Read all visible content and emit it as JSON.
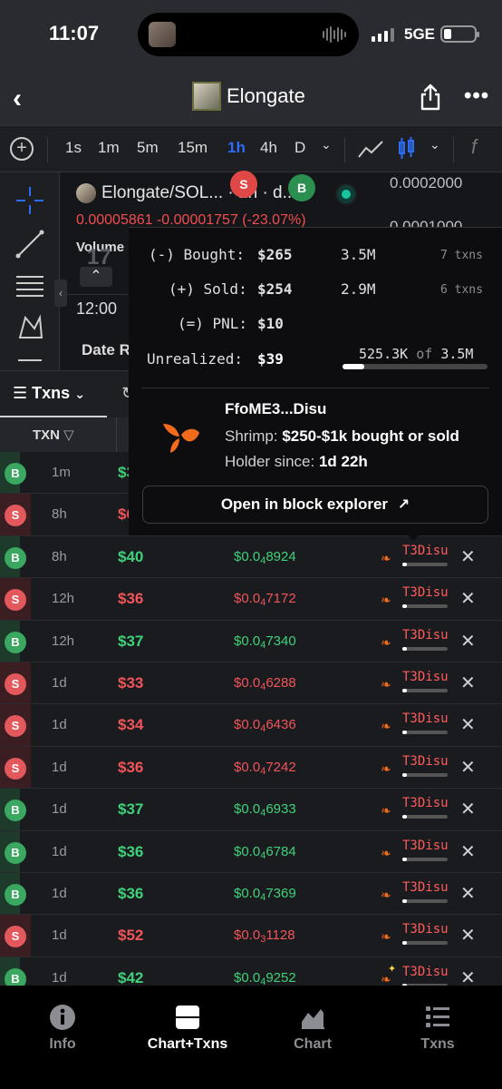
{
  "status": {
    "time": "11:07",
    "network": "5GE"
  },
  "nav": {
    "title": "Elongate"
  },
  "toolbar": {
    "intervals": [
      "1s",
      "1m",
      "5m",
      "15m",
      "1h",
      "4h",
      "D"
    ],
    "active_interval": "1h"
  },
  "chart": {
    "pair": "Elongate/SOL... · 1h · d...",
    "price_line": "0.00005861 -0.00001757 (-23.07%)",
    "volume_label": "Volume",
    "axis_prices": [
      "0.0002000",
      "0.0001000"
    ],
    "time_label": "12:00",
    "date_label": "Date R",
    "marker_sell": "S",
    "marker_buy": "B",
    "candle_label": "17"
  },
  "txns": {
    "tab_label": "Txns",
    "column_txn": "TXN",
    "rows": [
      {
        "type": "B",
        "age": "1m",
        "usd": "$3",
        "price_pre": "",
        "price_sub": "",
        "price_post": "",
        "maker": "",
        "bar": 0
      },
      {
        "type": "S",
        "age": "8h",
        "usd": "$6",
        "price_pre": "",
        "price_sub": "",
        "price_post": "",
        "maker": "",
        "bar": 0
      },
      {
        "type": "B",
        "age": "8h",
        "usd": "$40",
        "price_pre": "$0.0",
        "price_sub": "4",
        "price_post": "8924",
        "maker": "T3Disu",
        "bar": 0.1
      },
      {
        "type": "S",
        "age": "12h",
        "usd": "$36",
        "price_pre": "$0.0",
        "price_sub": "4",
        "price_post": "7172",
        "maker": "T3Disu",
        "bar": 0.1
      },
      {
        "type": "B",
        "age": "12h",
        "usd": "$37",
        "price_pre": "$0.0",
        "price_sub": "4",
        "price_post": "7340",
        "maker": "T3Disu",
        "bar": 0.1
      },
      {
        "type": "S",
        "age": "1d",
        "usd": "$33",
        "price_pre": "$0.0",
        "price_sub": "4",
        "price_post": "6288",
        "maker": "T3Disu",
        "bar": 0.1
      },
      {
        "type": "S",
        "age": "1d",
        "usd": "$34",
        "price_pre": "$0.0",
        "price_sub": "4",
        "price_post": "6436",
        "maker": "T3Disu",
        "bar": 0.1
      },
      {
        "type": "S",
        "age": "1d",
        "usd": "$36",
        "price_pre": "$0.0",
        "price_sub": "4",
        "price_post": "7242",
        "maker": "T3Disu",
        "bar": 0.1
      },
      {
        "type": "B",
        "age": "1d",
        "usd": "$37",
        "price_pre": "$0.0",
        "price_sub": "4",
        "price_post": "6933",
        "maker": "T3Disu",
        "bar": 0.1
      },
      {
        "type": "B",
        "age": "1d",
        "usd": "$36",
        "price_pre": "$0.0",
        "price_sub": "4",
        "price_post": "6784",
        "maker": "T3Disu",
        "bar": 0.1
      },
      {
        "type": "B",
        "age": "1d",
        "usd": "$36",
        "price_pre": "$0.0",
        "price_sub": "4",
        "price_post": "7369",
        "maker": "T3Disu",
        "bar": 0.1
      },
      {
        "type": "S",
        "age": "1d",
        "usd": "$52",
        "price_pre": "$0.0",
        "price_sub": "3",
        "price_post": "1128",
        "maker": "T3Disu",
        "bar": 0.1
      },
      {
        "type": "B",
        "age": "1d",
        "usd": "$42",
        "price_pre": "$0.0",
        "price_sub": "4",
        "price_post": "9252",
        "maker": "T3Disu",
        "bar": 0.1
      }
    ]
  },
  "popup": {
    "bought_label": "(-) Bought:",
    "bought_value": "$265",
    "bought_qty": "3.5M",
    "bought_txns": "7 txns",
    "sold_label": "(+) Sold:",
    "sold_value": "$254",
    "sold_qty": "2.9M",
    "sold_txns": "6 txns",
    "pnl_label": "(=) PNL:",
    "pnl_value": "$10",
    "unrealized_label": "Unrealized:",
    "unrealized_value": "$39",
    "holding": "525.3K",
    "holding_of": "of",
    "holding_total": "3.5M",
    "holding_fraction": 0.15,
    "wallet": "FfoME3...Disu",
    "tier_label": "Shrimp:",
    "tier_value": "$250-$1k bought or sold",
    "holder_label": "Holder since:",
    "holder_value": "1d 22h",
    "explorer_button": "Open in block explorer"
  },
  "tabbar": {
    "tabs": [
      "Info",
      "Chart+Txns",
      "Chart",
      "Txns"
    ],
    "active": "Chart+Txns"
  },
  "colors": {
    "buy": "#3fd17a",
    "sell": "#f0555a",
    "accent": "#2d6df6",
    "maker": "#ff5b5b",
    "shrimp_logo": "#f26a1b"
  }
}
